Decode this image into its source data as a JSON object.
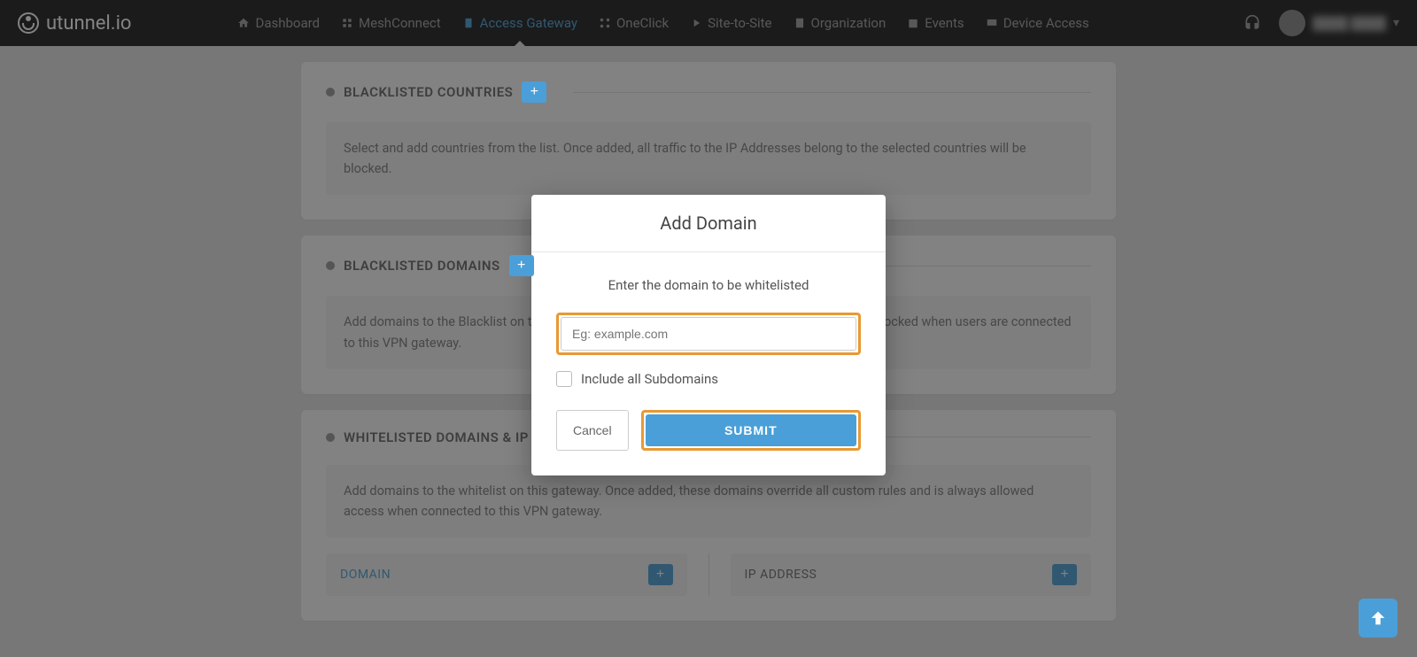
{
  "brand": "utunnel.io",
  "nav": {
    "dashboard": "Dashboard",
    "meshconnect": "MeshConnect",
    "access_gateway": "Access Gateway",
    "oneclick": "OneClick",
    "site": "Site-to-Site",
    "organization": "Organization",
    "events": "Events",
    "device_access": "Device Access"
  },
  "sections": {
    "blacklisted_countries": {
      "title": "BLACKLISTED COUNTRIES",
      "body": "Select and add countries from the list. Once added, all traffic to the IP Addresses belong to the selected countries will be blocked."
    },
    "blacklisted_domains": {
      "title": "BLACKLISTED DOMAINS",
      "body": "Add domains to the Blacklist on this gateway. Once added, all traffic to these domains will be blocked when users are connected to this VPN gateway."
    },
    "whitelisted": {
      "title": "WHITELISTED DOMAINS & IP ADDRESSES",
      "body": "Add domains to the whitelist on this gateway. Once added, these domains override all custom rules and is always allowed access when connected to this VPN gateway.",
      "domain_label": "DOMAIN",
      "ip_label": "IP ADDRESS"
    }
  },
  "modal": {
    "title": "Add Domain",
    "prompt": "Enter the domain to be whitelisted",
    "placeholder": "Eg: example.com",
    "checkbox": "Include all Subdomains",
    "cancel": "Cancel",
    "submit": "SUBMIT"
  },
  "plus": "+"
}
